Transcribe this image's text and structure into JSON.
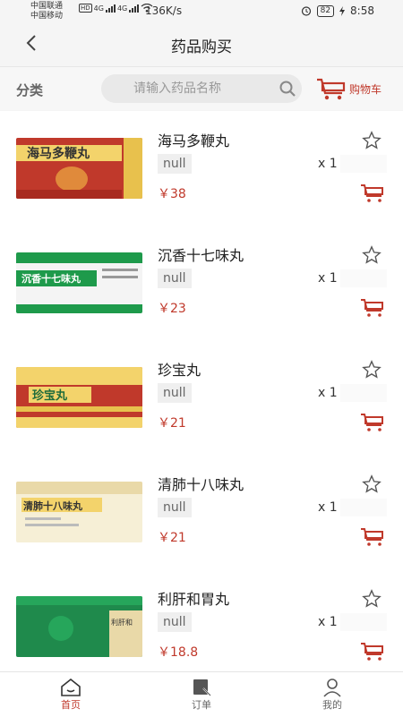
{
  "status_bar": {
    "carrier_1": "中国联通",
    "carrier_2": "中国移动",
    "hd": "HD",
    "net_1": "4G",
    "net_2": "4G",
    "speed": "136K/s",
    "battery": "82",
    "time": "8:58"
  },
  "header": {
    "title": "药品购买"
  },
  "toolbar": {
    "category_label": "分类",
    "search_placeholder": "请输入药品名称",
    "cart_label": "购物车"
  },
  "products": [
    {
      "name": "海马多鞭丸",
      "spec": "null",
      "qty": "x 1",
      "price": "￥38",
      "box_text": "海马多鞭丸",
      "box_color": "#c0392b"
    },
    {
      "name": "沉香十七味丸",
      "spec": "null",
      "qty": "x 1",
      "price": "￥23",
      "box_text": "沉香十七味丸",
      "box_color": "#1e9a4b"
    },
    {
      "name": "珍宝丸",
      "spec": "null",
      "qty": "x 1",
      "price": "￥21",
      "box_text": "珍宝丸",
      "box_color": "#c0392b"
    },
    {
      "name": "清肺十八味丸",
      "spec": "null",
      "qty": "x 1",
      "price": "￥21",
      "box_text": "清肺十八味丸",
      "box_color": "#e9d9a8"
    },
    {
      "name": "利肝和胃丸",
      "spec": "null",
      "qty": "x 1",
      "price": "￥18.8",
      "box_text": "利肝和",
      "box_color": "#1f8a4c"
    }
  ],
  "bottom_nav": [
    {
      "label": "首页",
      "active": true
    },
    {
      "label": "订单",
      "active": false
    },
    {
      "label": "我的",
      "active": false
    }
  ],
  "colors": {
    "accent": "#c0392b"
  }
}
